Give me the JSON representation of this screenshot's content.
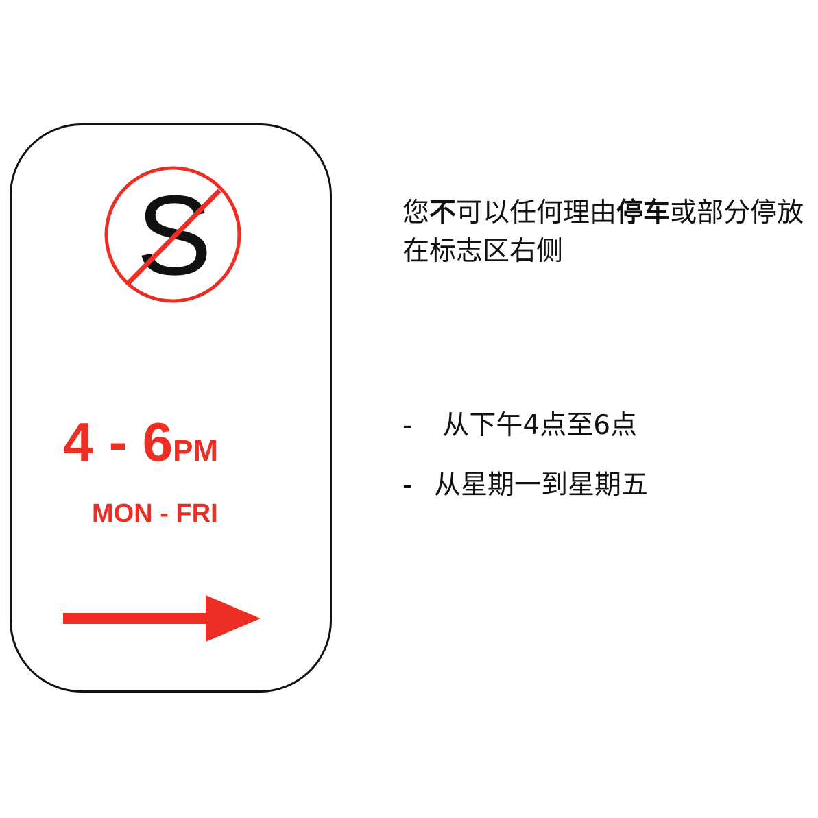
{
  "sign": {
    "time_range": "4 - 6",
    "time_suffix": "PM",
    "days": "MON - FRI",
    "icon": "no-stopping-icon",
    "arrow": "right-arrow-icon",
    "colors": {
      "red": "#ec2e24",
      "border": "#111111"
    }
  },
  "rule": {
    "parts": [
      {
        "text": "您",
        "bold": false
      },
      {
        "text": "不",
        "bold": true
      },
      {
        "text": "可以任何理由",
        "bold": false
      },
      {
        "text": "停车",
        "bold": true
      },
      {
        "text": "或部分停放在标志区右侧",
        "bold": false
      }
    ]
  },
  "bullets": [
    {
      "dash": "-",
      "text": " 从下午4点至6点"
    },
    {
      "dash": "-",
      "text": "从星期一到星期五"
    }
  ]
}
